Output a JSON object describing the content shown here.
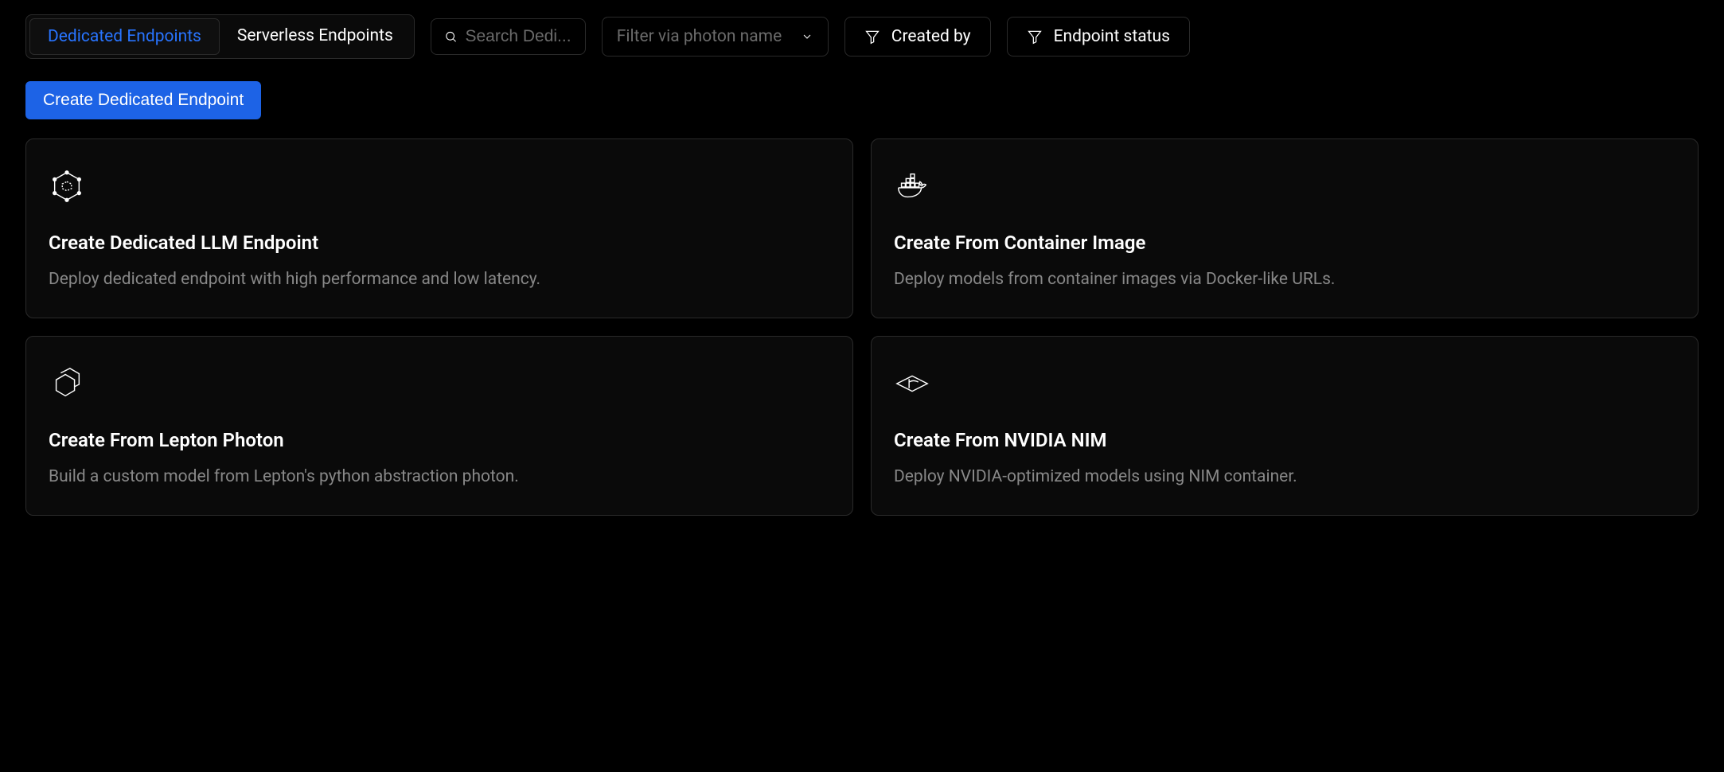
{
  "tabs": [
    {
      "label": "Dedicated Endpoints",
      "active": true
    },
    {
      "label": "Serverless Endpoints",
      "active": false
    }
  ],
  "search": {
    "placeholder": "Search Dedi..."
  },
  "photon_filter": {
    "placeholder": "Filter via photon name"
  },
  "filters": [
    {
      "label": "Created by"
    },
    {
      "label": "Endpoint status"
    }
  ],
  "create_button": "Create Dedicated Endpoint",
  "cards": [
    {
      "icon": "hexagon-network-icon",
      "title": "Create Dedicated LLM Endpoint",
      "description": "Deploy dedicated endpoint with high performance and low latency."
    },
    {
      "icon": "docker-icon",
      "title": "Create From Container Image",
      "description": "Deploy models from container images via Docker-like URLs."
    },
    {
      "icon": "hexagon-stack-icon",
      "title": "Create From Lepton Photon",
      "description": "Build a custom model from Lepton's python abstraction photon."
    },
    {
      "icon": "nvidia-icon",
      "title": "Create From NVIDIA NIM",
      "description": "Deploy NVIDIA-optimized models using NIM container."
    }
  ]
}
